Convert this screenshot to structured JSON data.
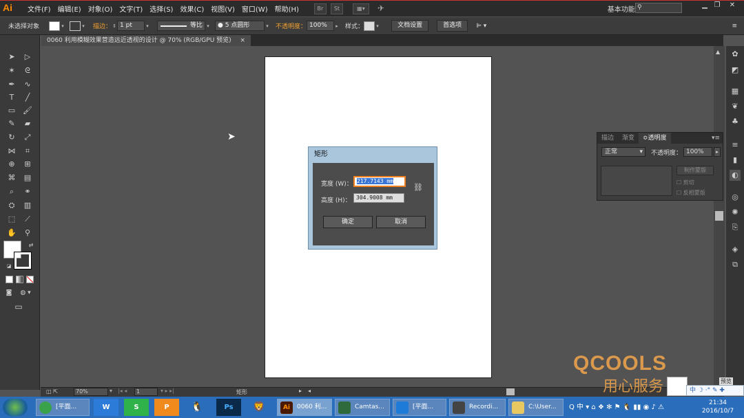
{
  "app": {
    "logo": "Ai",
    "workspace": "基本功能 ▾"
  },
  "menu": [
    "文件(F)",
    "编辑(E)",
    "对象(O)",
    "文字(T)",
    "选择(S)",
    "效果(C)",
    "视图(V)",
    "窗口(W)",
    "帮助(H)"
  ],
  "menu_icons": [
    "Br",
    "St"
  ],
  "control": {
    "selection": "未选择对象",
    "stroke_label": "描边：",
    "stroke_value": "1 pt",
    "profile": "等比",
    "brush": "● 5 点圆形",
    "opacity_label": "不透明度：",
    "opacity_value": "100%",
    "style_label": "样式：",
    "doc_settings": "文档设置",
    "prefs": "首选项"
  },
  "doc_tab": {
    "title": "0060 利用模糊效果营造远近透视的设计 @ 70% (RGB/GPU 预览)",
    "close": "×"
  },
  "dialog": {
    "title": "矩形",
    "width_label": "宽度 (W)：",
    "width_value": "217.7143 mm",
    "height_label": "高度 (H)：",
    "height_value": "304.9008 mm",
    "ok": "确定",
    "cancel": "取消"
  },
  "transparency_panel": {
    "tabs": [
      "描边",
      "渐变",
      "≎透明度"
    ],
    "mode": "正常",
    "opacity_label": "不透明度：",
    "opacity_value": "100%",
    "make_mask": "制作蒙版",
    "clip": "剪切",
    "invert": "反相蒙版"
  },
  "status": {
    "zoom": "70%",
    "page": "1",
    "tool": "矩形"
  },
  "taskbar": {
    "apps": [
      {
        "label": "[平面...",
        "color": "#3aa24a"
      },
      {
        "label": "",
        "color": "#2d7bd8",
        "glyph": "W"
      },
      {
        "label": "",
        "color": "#2fb24a",
        "glyph": "S"
      },
      {
        "label": "",
        "color": "#f08a1c",
        "glyph": "P"
      },
      {
        "label": "",
        "color": "#222222",
        "glyph": "🐧"
      },
      {
        "label": "",
        "color": "#0b2a4a",
        "glyph": "Ps"
      },
      {
        "label": "",
        "color": "#d84a2a",
        "glyph": "🦁"
      },
      {
        "label": "0060 利...",
        "color": "#4a1a00",
        "glyph": "Ai"
      },
      {
        "label": "Camtas...",
        "color": "#2e6a3a"
      },
      {
        "label": "[平面...",
        "color": "#1e7bd8"
      },
      {
        "label": "Recordi...",
        "color": "#444444"
      },
      {
        "label": "C:\\User...",
        "color": "#e8c860"
      }
    ],
    "time": "21:34",
    "date": "2016/10/7"
  },
  "watermark": {
    "logo": "QCOOLS",
    "text": "用心服务"
  },
  "right_panel_overlay": {
    "preview": "预览",
    "ime": "中"
  }
}
